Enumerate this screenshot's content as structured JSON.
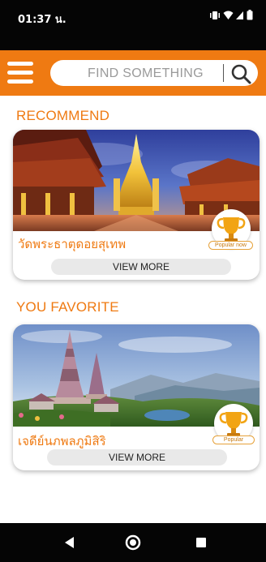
{
  "status_bar": {
    "time": "01:37 น.",
    "icons": [
      "vibrate-icon",
      "wifi-icon",
      "signal-icon",
      "battery-icon"
    ]
  },
  "header": {
    "menu_icon": "hamburger-menu-icon",
    "search_placeholder": "FIND SOMETHING",
    "search_icon": "search-icon"
  },
  "sections": {
    "recommend": {
      "title": "RECOMMEND",
      "card": {
        "name": "วัดพระธาตุดอยสุเทพ",
        "button": "VIEW MORE",
        "badge_label": "Popular now",
        "badge_icon": "trophy-icon"
      }
    },
    "favorite": {
      "title": "YOU FAVORITE",
      "card": {
        "name": "เจดีย์นภพลภูมิสิริ",
        "button": "VIEW MORE",
        "badge_label": "Popular",
        "badge_icon": "trophy-icon"
      }
    }
  },
  "nav_bar": {
    "buttons": [
      "back-icon",
      "home-icon",
      "recents-icon"
    ]
  },
  "colors": {
    "accent": "#ef7a12",
    "status_bar": "#050505",
    "button_bg": "#e9e9e9"
  }
}
